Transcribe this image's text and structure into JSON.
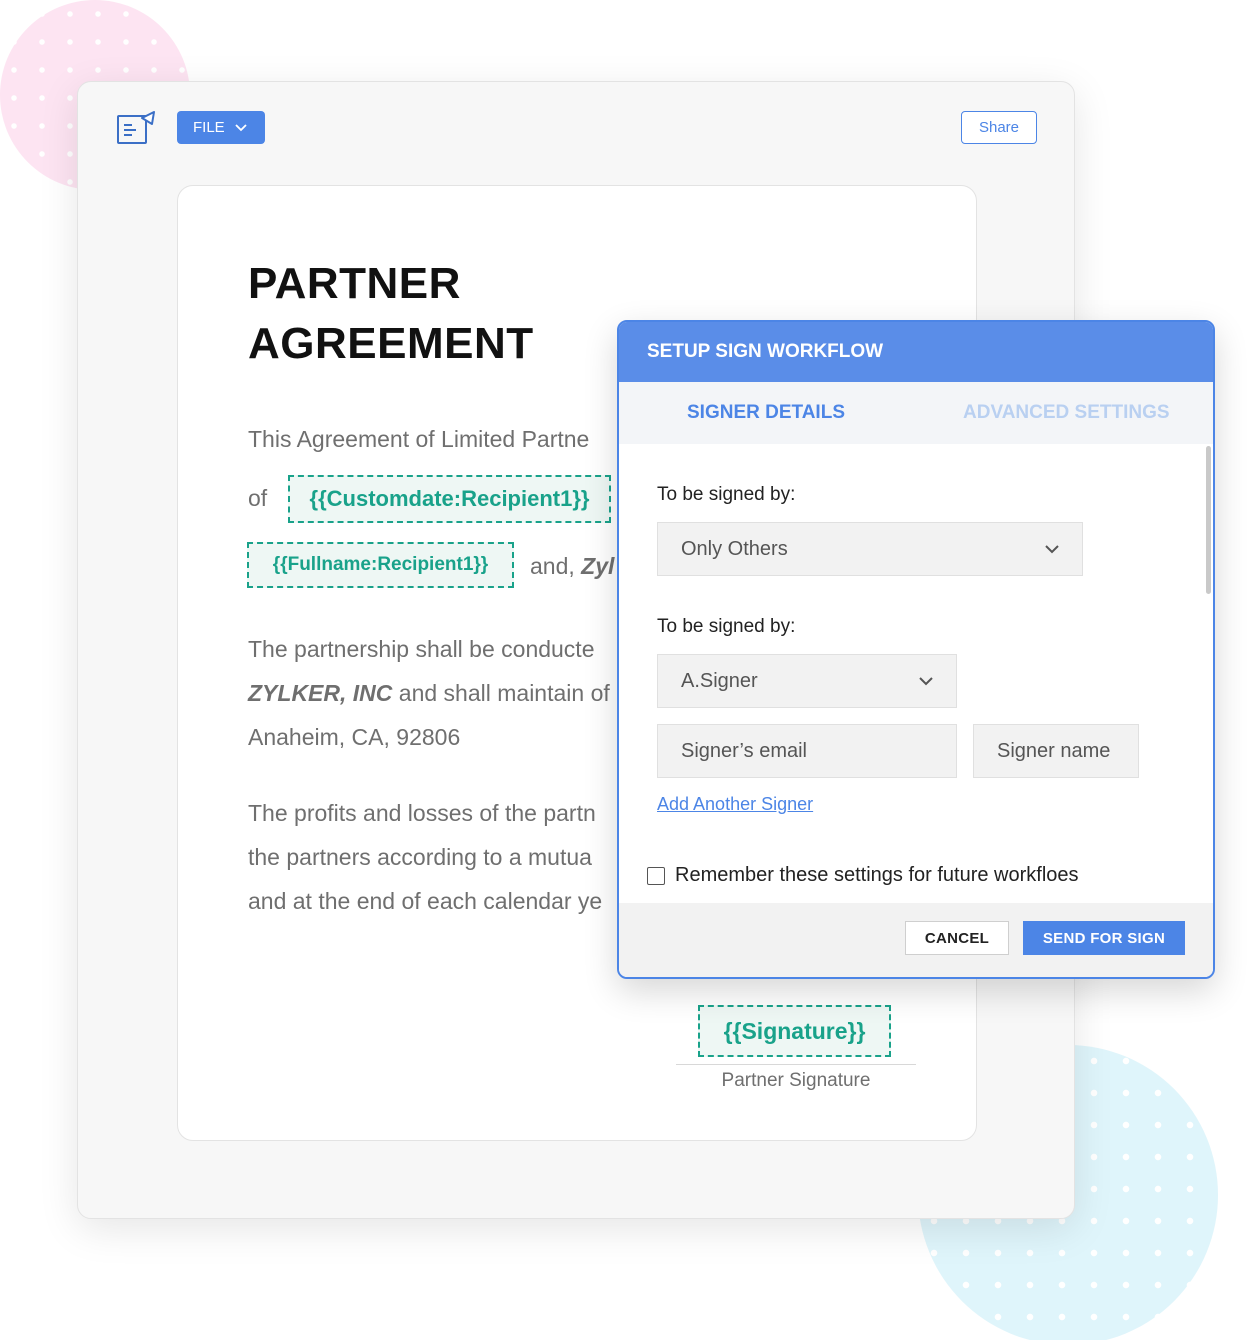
{
  "toolbar": {
    "file_label": "FILE",
    "share_label": "Share"
  },
  "document": {
    "title": "PARTNER AGREEMENT",
    "para1": {
      "line1": "This Agreement of Limited Partne",
      "of": "of",
      "date_tag": "{{Customdate:Recipient1}}",
      "name_tag": "{{Fullname:Recipient1}}",
      "and_prefix": "and,",
      "and_company": "Zyl"
    },
    "para2": {
      "line1": "The partnership shall be conducte",
      "company": "ZYLKER, INC",
      "line2_rest": "and shall maintain of",
      "line3": "Anaheim, CA, 92806"
    },
    "para3": {
      "line1": "The profits and losses of the partn",
      "line2": "the partners according to a mutua",
      "line3": "and at the end of each calendar ye"
    },
    "signature_tag": "{{Signature}}",
    "signature_label": "Partner Signature"
  },
  "modal": {
    "title": "SETUP SIGN WORKFLOW",
    "tabs": {
      "signer_details": "SIGNER DETAILS",
      "advanced_settings": "ADVANCED SETTINGS"
    },
    "signed_by_label_1": "To be signed by:",
    "signed_by_value": "Only Others",
    "signed_by_label_2": "To be signed by:",
    "signer_value": "A.Signer",
    "email_placeholder": "Signer’s email",
    "name_placeholder": "Signer name",
    "add_signer": "Add Another Signer",
    "remember_label": "Remember these settings for future workfloes",
    "cancel_label": "CANCEL",
    "send_label": "SEND FOR SIGN"
  },
  "colors": {
    "accent": "#4c85e6",
    "header": "#5a8de8",
    "tag": "#19a28a"
  }
}
